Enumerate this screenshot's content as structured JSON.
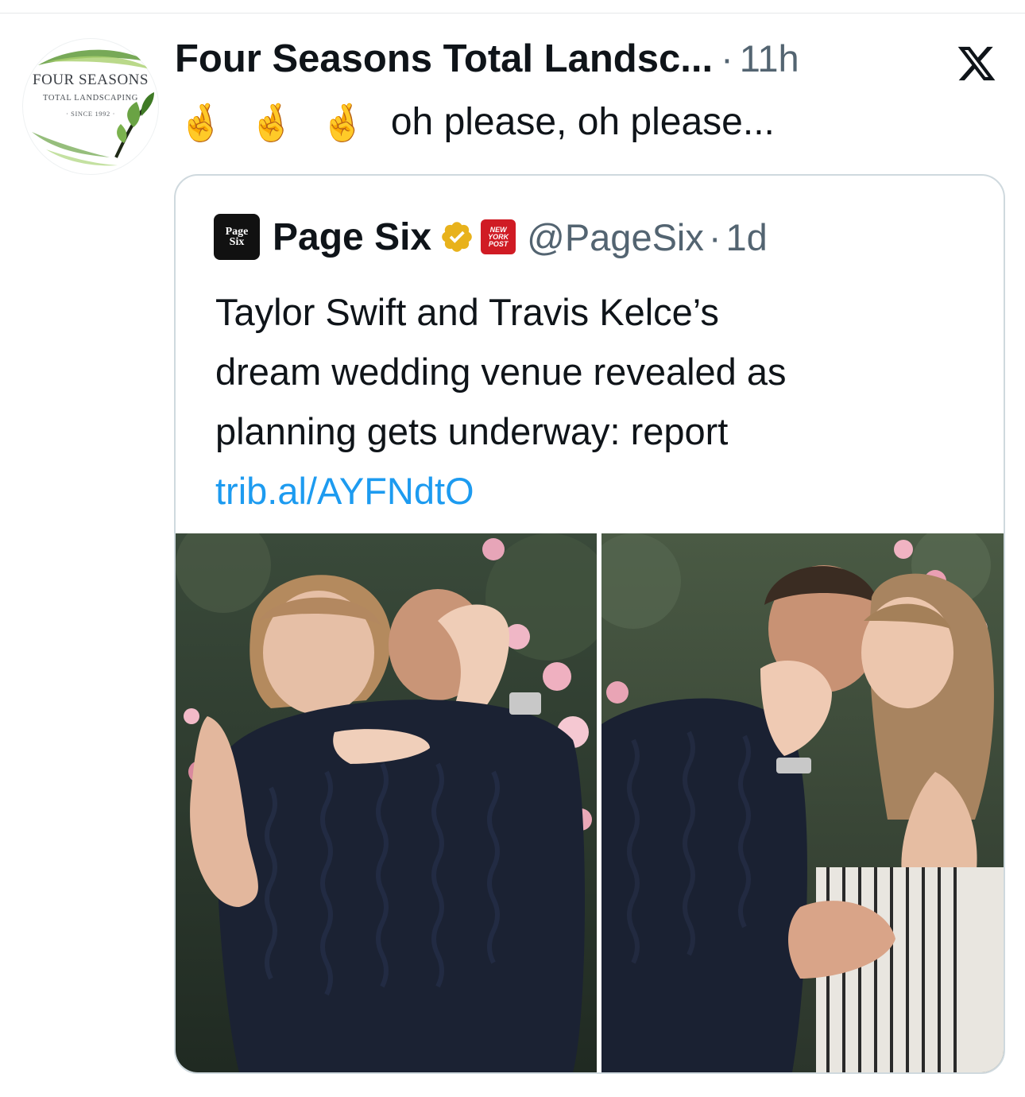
{
  "tweet": {
    "author_name": "Four Seasons Total Landsc...",
    "dot": "·",
    "timestamp": "11h",
    "emojis": [
      "🤞",
      "🤞",
      "🤞"
    ],
    "text": "oh please, oh please...",
    "platform_icon": "x-logo-icon"
  },
  "avatar": {
    "line1": "FOUR SEASONS",
    "line2": "TOTAL LANDSCAPING",
    "line3": "· SINCE 1992 ·"
  },
  "quote": {
    "avatar_text_1": "Page",
    "avatar_text_2": "Six",
    "name": "Page Six",
    "verified_icon": "verified-badge-icon",
    "affiliate_badge": [
      "NEW",
      "YORK",
      "POST"
    ],
    "handle": "@PageSix",
    "dot": "·",
    "timestamp": "1d",
    "text_lines": [
      "Taylor Swift and Travis Kelce’s",
      "dream wedding venue revealed as",
      "planning gets underway: report"
    ],
    "link": "trib.al/AYFNdtO"
  },
  "colors": {
    "text_primary": "#0f1419",
    "text_secondary": "#536471",
    "link": "#1d9bf0",
    "card_border": "#cfd9de",
    "verified_gold": "#e8b21c",
    "nyp_red": "#d01b24"
  }
}
